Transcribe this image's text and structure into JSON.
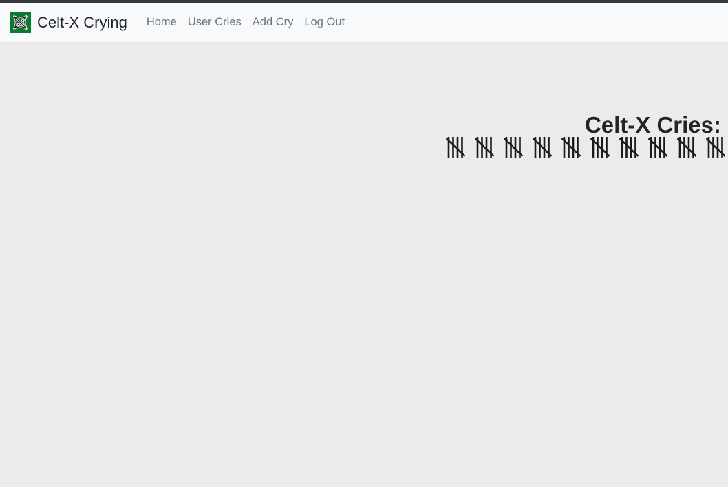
{
  "window": {
    "background_color": "#ebebeb",
    "top_strip_color": "#343a40"
  },
  "navbar": {
    "background_color": "#f8f9fa",
    "brand": {
      "text": "Celt-X Crying",
      "icon": "celt-x-knot-logo",
      "logo_background_color": "#0d7a33",
      "text_color": "#212529"
    },
    "link_color": "#6c757d",
    "links": [
      {
        "label": "Home",
        "name": "nav-link-home"
      },
      {
        "label": "User Cries",
        "name": "nav-link-user-cries"
      },
      {
        "label": "Add Cry",
        "name": "nav-link-add-cry"
      },
      {
        "label": "Log Out",
        "name": "nav-link-log-out"
      }
    ]
  },
  "main": {
    "heading": "Celt-X Cries:",
    "heading_color": "#212529",
    "tally": {
      "icon": "tally-mark-five",
      "groups_visible": 10,
      "marks_per_group": 5,
      "total_count": 50,
      "color": "#1b1b1b"
    }
  }
}
